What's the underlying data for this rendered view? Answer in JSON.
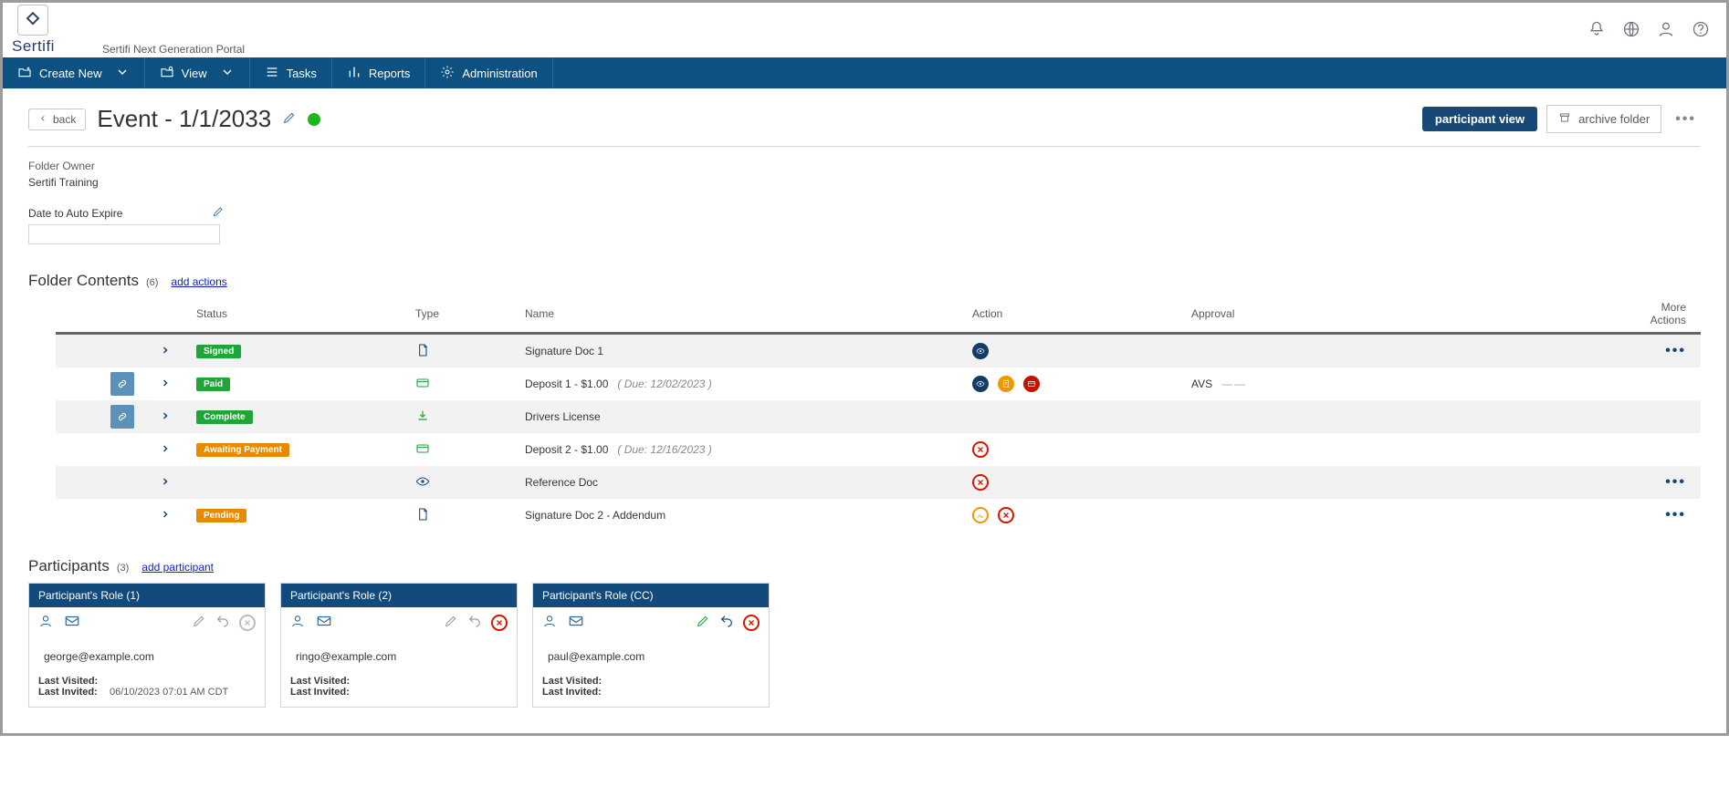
{
  "brand": {
    "name": "Sertifi",
    "portal": "Sertifi Next Generation Portal"
  },
  "nav": {
    "create_new": "Create New",
    "view": "View",
    "tasks": "Tasks",
    "reports": "Reports",
    "administration": "Administration"
  },
  "title_bar": {
    "back": "back",
    "title": "Event - 1/1/2033",
    "participant_view": "participant view",
    "archive_folder": "archive folder"
  },
  "folder_meta": {
    "owner_label": "Folder Owner",
    "owner_value": "Sertifi Training",
    "auto_expire_label": "Date to Auto Expire"
  },
  "contents": {
    "heading": "Folder Contents",
    "count": "(6)",
    "add_link": "add actions",
    "columns": {
      "status": "Status",
      "type": "Type",
      "name": "Name",
      "action": "Action",
      "approval": "Approval",
      "more": "More Actions"
    },
    "rows": [
      {
        "link_chip": false,
        "status": {
          "label": "Signed",
          "tone": "green"
        },
        "type_icon": "doc-sign",
        "name": "Signature Doc 1",
        "due": null,
        "actions": [
          "eye-blue"
        ],
        "approval_label": null,
        "approval_dash": false,
        "more": true,
        "alt": true
      },
      {
        "link_chip": true,
        "status": {
          "label": "Paid",
          "tone": "green"
        },
        "type_icon": "card",
        "name": "Deposit 1 - $1.00",
        "due": "( Due: 12/02/2023 )",
        "actions": [
          "eye-blue",
          "receipt",
          "card-red"
        ],
        "approval_label": "AVS",
        "approval_dash": true,
        "more": false,
        "alt": false
      },
      {
        "link_chip": true,
        "status": {
          "label": "Complete",
          "tone": "green"
        },
        "type_icon": "download",
        "name": "Drivers License",
        "due": null,
        "actions": [],
        "approval_label": null,
        "approval_dash": false,
        "more": false,
        "alt": true
      },
      {
        "link_chip": false,
        "status": {
          "label": "Awaiting Payment",
          "tone": "orange"
        },
        "type_icon": "card",
        "name": "Deposit 2 - $1.00",
        "due": "( Due: 12/16/2023 )",
        "actions": [
          "cancel-red"
        ],
        "approval_label": null,
        "approval_dash": false,
        "more": false,
        "alt": false
      },
      {
        "link_chip": false,
        "status": null,
        "type_icon": "eye",
        "name": "Reference Doc",
        "due": null,
        "actions": [
          "cancel-red"
        ],
        "approval_label": null,
        "approval_dash": false,
        "more": true,
        "alt": true
      },
      {
        "link_chip": false,
        "status": {
          "label": "Pending",
          "tone": "orange"
        },
        "type_icon": "doc-sign",
        "name": "Signature Doc 2 - Addendum",
        "due": null,
        "actions": [
          "sign-orange",
          "cancel-red"
        ],
        "approval_label": null,
        "approval_dash": false,
        "more": true,
        "alt": false
      }
    ]
  },
  "participants": {
    "heading": "Participants",
    "count": "(3)",
    "add_link": "add participant",
    "cards": [
      {
        "role": "Participant's Role (1)",
        "email": "george@example.com",
        "last_visited_label": "Last Visited:",
        "last_visited_value": "",
        "last_invited_label": "Last Invited:",
        "last_invited_value": "06/10/2023 07:01 AM CDT",
        "remove_active": false,
        "edit_active": false,
        "undo_active": false
      },
      {
        "role": "Participant's Role (2)",
        "email": "ringo@example.com",
        "last_visited_label": "Last Visited:",
        "last_visited_value": "",
        "last_invited_label": "Last Invited:",
        "last_invited_value": "",
        "remove_active": true,
        "edit_active": false,
        "undo_active": false
      },
      {
        "role": "Participant's Role (CC)",
        "email": "paul@example.com",
        "last_visited_label": "Last Visited:",
        "last_visited_value": "",
        "last_invited_label": "Last Invited:",
        "last_invited_value": "",
        "remove_active": true,
        "edit_active": true,
        "undo_active": true
      }
    ]
  }
}
